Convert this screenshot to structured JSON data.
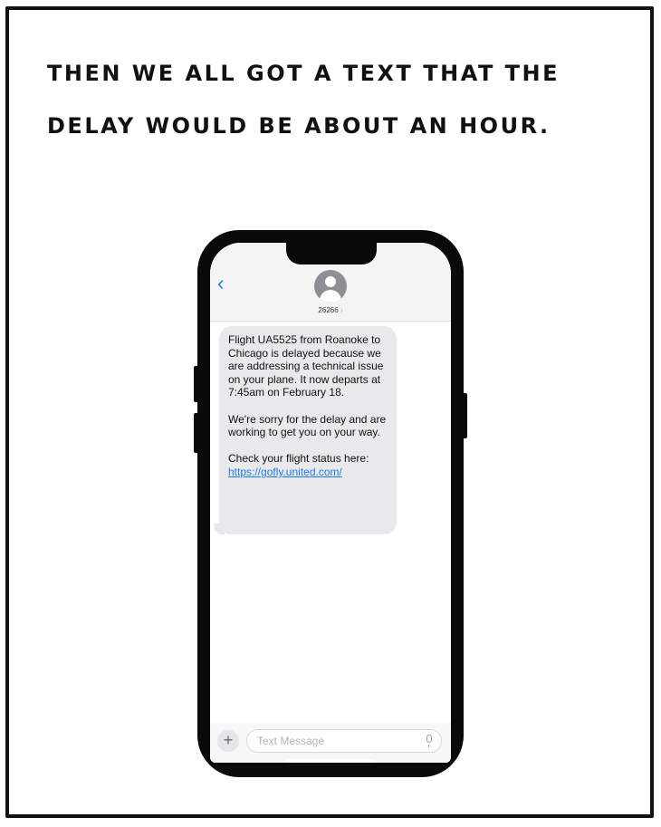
{
  "caption": {
    "line1": "THEN WE ALL GOT A TEXT THAT THE",
    "line2": "DELAY WOULD BE ABOUT AN HOUR."
  },
  "phone": {
    "header": {
      "back_icon": "chevron-left-icon",
      "avatar_icon": "person-icon",
      "contact_name": "26266",
      "contact_chevron": "›"
    },
    "message": {
      "paragraph1": "Flight UA5525 from Roanoke to Chicago is delayed because we are addressing a technical issue on your plane. It now departs at 7:45am on February 18.",
      "paragraph2": "We're sorry for the delay and are working to get you on your way.",
      "paragraph3": "Check your flight status here:",
      "link": "https://gofly.united.com/"
    },
    "input_bar": {
      "plus_label": "+",
      "placeholder": "Text Message",
      "value": "",
      "mic_icon": "microphone-icon"
    }
  },
  "colors": {
    "ios_blue": "#1b7cf2",
    "bubble_gray": "#e9e9eb",
    "avatar_gray": "#8e8e94"
  }
}
